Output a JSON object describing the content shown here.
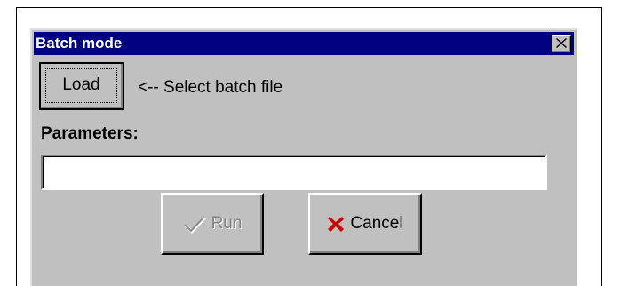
{
  "dialog": {
    "title": "Batch mode",
    "close_label": "close",
    "load_button_label": "Load",
    "load_hint": "<-- Select batch file",
    "parameters_label": "Parameters:",
    "parameters_value": "",
    "run_button_label": "Run",
    "run_enabled": false,
    "cancel_button_label": "Cancel"
  },
  "icons": {
    "close": "close-x-icon",
    "run": "checkmark-icon",
    "cancel": "red-x-icon"
  },
  "colors": {
    "titlebar": "#000080",
    "dialog_face": "#c0c0c0",
    "cancel_icon": "#cc0000",
    "disabled_text": "#808080"
  }
}
